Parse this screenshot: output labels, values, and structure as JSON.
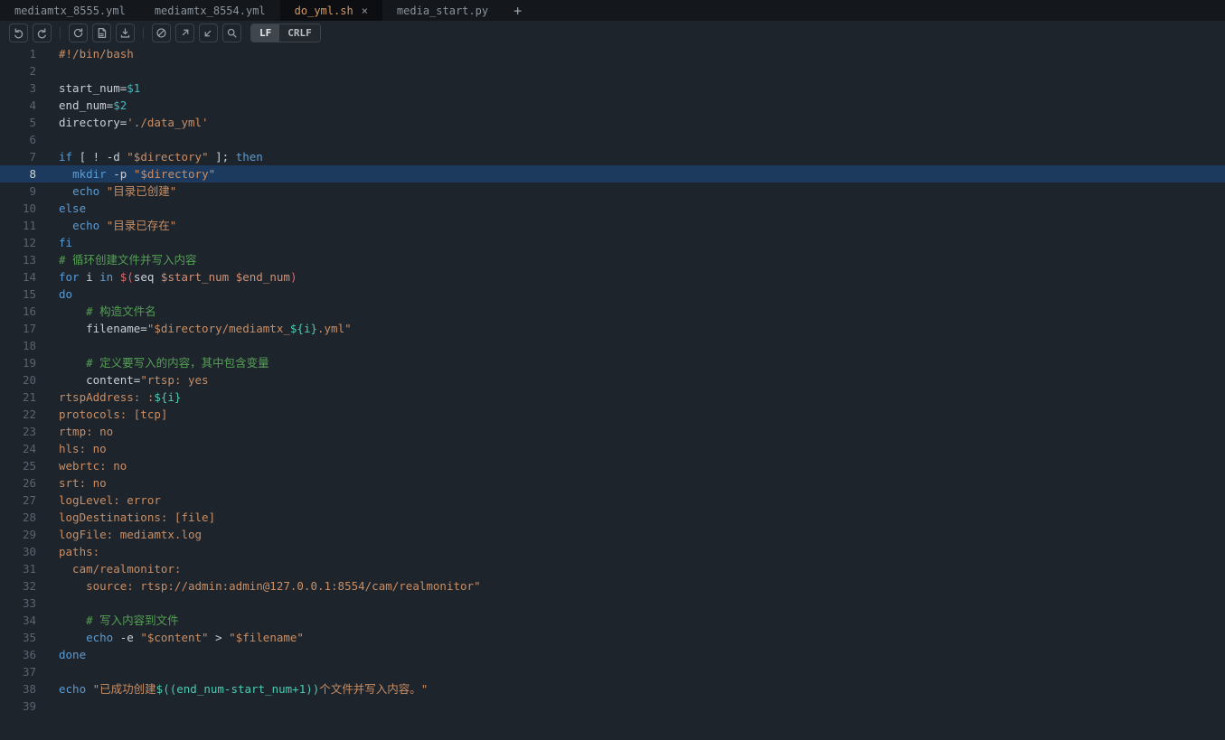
{
  "tabs": [
    {
      "label": "mediamtx_8555.yml",
      "active": false
    },
    {
      "label": "mediamtx_8554.yml",
      "active": false
    },
    {
      "label": "do_yml.sh",
      "active": true,
      "close_label": "×"
    },
    {
      "label": "media_start.py",
      "active": false
    }
  ],
  "tabbar": {
    "new_tab": "+"
  },
  "toolbar": {
    "buttons": [
      "undo",
      "redo",
      "reload",
      "save-document",
      "download",
      "slash-circle",
      "arrow-up-right",
      "arrow-down-left",
      "search"
    ],
    "eol": {
      "lf": "LF",
      "crlf": "CRLF",
      "selected": "LF"
    }
  },
  "colors": {
    "background": "#1d242b",
    "tabbar_bg": "#14171b",
    "active_tab_bg": "#0c0e11",
    "active_tab_text": "#d19a66",
    "inactive_tab_text": "#8a929b",
    "toolbar_icon": "#9aa2ab",
    "button_border": "#3c434b",
    "eol_selected_bg": "#3f464e",
    "gutter_text": "#5a6370",
    "active_line_bg": "#1c3a5e",
    "default_text": "#c9cfd6",
    "keyword": "#5b9bd3",
    "string": "#c98e66",
    "comment": "#55a055",
    "variable": "#4db5bd",
    "warm_variable": "#ce9178",
    "expansion": "#4ec9b0",
    "punctuation": "#d96a6a"
  },
  "editor": {
    "language": "shell",
    "active_line": 8,
    "total_lines": 39,
    "lines": [
      {
        "n": 1,
        "s": [
          {
            "t": "#!/bin/bash",
            "c": "str"
          }
        ]
      },
      {
        "n": 2,
        "s": []
      },
      {
        "n": 3,
        "s": [
          {
            "t": "start_num=",
            "c": "def"
          },
          {
            "t": "$1",
            "c": "var"
          }
        ]
      },
      {
        "n": 4,
        "s": [
          {
            "t": "end_num=",
            "c": "def"
          },
          {
            "t": "$2",
            "c": "var"
          }
        ]
      },
      {
        "n": 5,
        "s": [
          {
            "t": "directory=",
            "c": "def"
          },
          {
            "t": "'./data_yml'",
            "c": "str"
          }
        ]
      },
      {
        "n": 6,
        "s": []
      },
      {
        "n": 7,
        "s": [
          {
            "t": "if",
            "c": "kw"
          },
          {
            "t": " [ ! -d ",
            "c": "def"
          },
          {
            "t": "\"$directory\"",
            "c": "str"
          },
          {
            "t": " ]; ",
            "c": "def"
          },
          {
            "t": "then",
            "c": "kw"
          }
        ]
      },
      {
        "n": 8,
        "s": [
          {
            "t": "  ",
            "c": "def"
          },
          {
            "t": "mkdir",
            "c": "cmd"
          },
          {
            "t": " -p ",
            "c": "def"
          },
          {
            "t": "\"$directory\"",
            "c": "str"
          }
        ]
      },
      {
        "n": 9,
        "s": [
          {
            "t": "  ",
            "c": "def"
          },
          {
            "t": "echo",
            "c": "cmd"
          },
          {
            "t": " ",
            "c": "def"
          },
          {
            "t": "\"目录已创建\"",
            "c": "str"
          }
        ]
      },
      {
        "n": 10,
        "s": [
          {
            "t": "else",
            "c": "kw"
          }
        ]
      },
      {
        "n": 11,
        "s": [
          {
            "t": "  ",
            "c": "def"
          },
          {
            "t": "echo",
            "c": "cmd"
          },
          {
            "t": " ",
            "c": "def"
          },
          {
            "t": "\"目录已存在\"",
            "c": "str"
          }
        ]
      },
      {
        "n": 12,
        "s": [
          {
            "t": "fi",
            "c": "kw"
          }
        ]
      },
      {
        "n": 13,
        "s": [
          {
            "t": "# 循环创建文件并写入内容",
            "c": "com"
          }
        ]
      },
      {
        "n": 14,
        "s": [
          {
            "t": "for",
            "c": "kw"
          },
          {
            "t": " i ",
            "c": "def"
          },
          {
            "t": "in",
            "c": "kw"
          },
          {
            "t": " ",
            "c": "def"
          },
          {
            "t": "$(",
            "c": "pun"
          },
          {
            "t": "seq ",
            "c": "def"
          },
          {
            "t": "$start_num",
            "c": "varw"
          },
          {
            "t": " ",
            "c": "def"
          },
          {
            "t": "$end_num",
            "c": "varw"
          },
          {
            "t": ")",
            "c": "pun"
          }
        ]
      },
      {
        "n": 15,
        "s": [
          {
            "t": "do",
            "c": "kw"
          }
        ]
      },
      {
        "n": 16,
        "s": [
          {
            "t": "    ",
            "c": "def"
          },
          {
            "t": "# 构造文件名",
            "c": "com"
          }
        ]
      },
      {
        "n": 17,
        "s": [
          {
            "t": "    filename=",
            "c": "def"
          },
          {
            "t": "\"$directory/mediamtx_",
            "c": "str"
          },
          {
            "t": "${i}",
            "c": "esc"
          },
          {
            "t": ".yml\"",
            "c": "str"
          }
        ]
      },
      {
        "n": 18,
        "s": []
      },
      {
        "n": 19,
        "s": [
          {
            "t": "    ",
            "c": "def"
          },
          {
            "t": "# 定义要写入的内容，其中包含变量",
            "c": "com"
          }
        ]
      },
      {
        "n": 20,
        "s": [
          {
            "t": "    content=",
            "c": "def"
          },
          {
            "t": "\"rtsp: yes",
            "c": "str"
          }
        ]
      },
      {
        "n": 21,
        "s": [
          {
            "t": "rtspAddress: :",
            "c": "str"
          },
          {
            "t": "${i}",
            "c": "esc"
          }
        ]
      },
      {
        "n": 22,
        "s": [
          {
            "t": "protocols: [tcp]",
            "c": "str"
          }
        ]
      },
      {
        "n": 23,
        "s": [
          {
            "t": "rtmp: no",
            "c": "str"
          }
        ]
      },
      {
        "n": 24,
        "s": [
          {
            "t": "hls: no",
            "c": "str"
          }
        ]
      },
      {
        "n": 25,
        "s": [
          {
            "t": "webrtc: no",
            "c": "str"
          }
        ]
      },
      {
        "n": 26,
        "s": [
          {
            "t": "srt: no",
            "c": "str"
          }
        ]
      },
      {
        "n": 27,
        "s": [
          {
            "t": "logLevel: error",
            "c": "str"
          }
        ]
      },
      {
        "n": 28,
        "s": [
          {
            "t": "logDestinations: [file]",
            "c": "str"
          }
        ]
      },
      {
        "n": 29,
        "s": [
          {
            "t": "logFile: mediamtx.log",
            "c": "str"
          }
        ]
      },
      {
        "n": 30,
        "s": [
          {
            "t": "paths:",
            "c": "str"
          }
        ]
      },
      {
        "n": 31,
        "s": [
          {
            "t": "  cam/realmonitor:",
            "c": "str"
          }
        ]
      },
      {
        "n": 32,
        "s": [
          {
            "t": "    source: rtsp://admin:admin@127.0.0.1:8554/cam/realmonitor\"",
            "c": "str"
          }
        ]
      },
      {
        "n": 33,
        "s": []
      },
      {
        "n": 34,
        "s": [
          {
            "t": "    ",
            "c": "def"
          },
          {
            "t": "# 写入内容到文件",
            "c": "com"
          }
        ]
      },
      {
        "n": 35,
        "s": [
          {
            "t": "    ",
            "c": "def"
          },
          {
            "t": "echo",
            "c": "cmd"
          },
          {
            "t": " -e ",
            "c": "def"
          },
          {
            "t": "\"$content\"",
            "c": "str"
          },
          {
            "t": " > ",
            "c": "def"
          },
          {
            "t": "\"$filename\"",
            "c": "str"
          }
        ]
      },
      {
        "n": 36,
        "s": [
          {
            "t": "done",
            "c": "kw"
          }
        ]
      },
      {
        "n": 37,
        "s": []
      },
      {
        "n": 38,
        "s": [
          {
            "t": "echo",
            "c": "cmd"
          },
          {
            "t": " ",
            "c": "def"
          },
          {
            "t": "\"已成功创建",
            "c": "str"
          },
          {
            "t": "$((end_num-start_num+1))",
            "c": "esc"
          },
          {
            "t": "个文件并写入内容。\"",
            "c": "str"
          }
        ]
      },
      {
        "n": 39,
        "s": []
      }
    ]
  }
}
